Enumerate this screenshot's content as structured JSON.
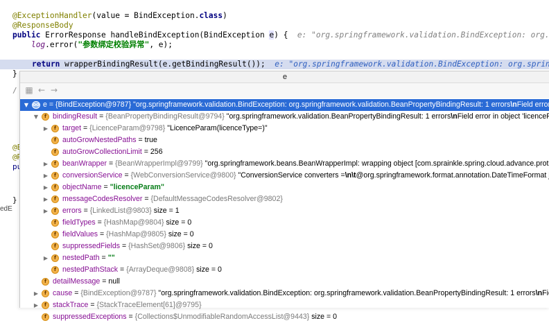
{
  "editor": {
    "line1_anno": "@ExceptionHandler",
    "line1_rest": "(value = BindException.",
    "line1_kw": "class",
    "line1_end": ")",
    "line2_anno": "@ResponseBody",
    "line3_kw": "public",
    "line3_text": " ErrorResponse handleBindException(BindException ",
    "line3_param": "e",
    "line3_end": ") {",
    "line3_hint": "  e: \"org.springframework.validation.BindException: org.",
    "line4_field": "log",
    "line4_text": ".error(",
    "line4_str": "\"参数绑定校验异常\"",
    "line4_end": ", e);",
    "line5_kw": "return",
    "line5_text": " wrapperBindingResult(e.getBindingResult());",
    "line5_hint": "  e: \"org.springframework.validation.BindException: org.sprin",
    "line6": "}",
    "frag_comment": "/",
    "frag_at1": "@E",
    "frag_at2": "@R",
    "frag_pu": "pu",
    "frag_close": "}",
    "frag_ed": "edE"
  },
  "popup": {
    "title": "e",
    "toolbar": {
      "icons": [
        "grid-icon",
        "back-arrow-icon",
        "forward-arrow-icon"
      ]
    },
    "rows": [
      {
        "twisty": "▼",
        "icon": "oo",
        "name": "e",
        "ref": "{BindException@9787}",
        "value": " \"org.springframework.validation.BindException: org.springframework.validation.BeanPropertyBindingResult: 1 errors",
        "bold": "\\n",
        "value2": "Field error in"
      },
      {
        "twisty": "▼",
        "icon": "f",
        "name": "bindingResult",
        "ref": "{BeanPropertyBindingResult@9794}",
        "value": " \"org.springframework.validation.BeanPropertyBindingResult: 1 errors",
        "bold": "\\n",
        "value2": "Field error in object 'licenceParam"
      },
      {
        "twisty": "▶",
        "icon": "f",
        "name": "target",
        "ref": "{LicenceParam@9798}",
        "value": " \"LicenceParam(licenceType=)\"",
        "bold": "",
        "value2": ""
      },
      {
        "twisty": "",
        "icon": "f",
        "name": "autoGrowNestedPaths",
        "ref": "",
        "value": " true",
        "bold": "",
        "value2": ""
      },
      {
        "twisty": "",
        "icon": "f",
        "name": "autoGrowCollectionLimit",
        "ref": "",
        "value": " 256",
        "bold": "",
        "value2": ""
      },
      {
        "twisty": "▶",
        "icon": "f",
        "name": "beanWrapper",
        "ref": "{BeanWrapperImpl@9799}",
        "value": " \"org.springframework.beans.BeanWrapperImpl: wrapping object [com.sprainkle.spring.cloud.advance.proto.li",
        "bold": "",
        "value2": ""
      },
      {
        "twisty": "▶",
        "icon": "f",
        "name": "conversionService",
        "ref": "{WebConversionService@9800}",
        "value": " \"ConversionService converters =",
        "bold": "\\n\\t",
        "value2": "@org.springframework.format.annotation.DateTimeFormat java"
      },
      {
        "twisty": "▶",
        "icon": "f",
        "name": "objectName",
        "ref": "",
        "value": "",
        "bold": "",
        "value2": "",
        "strval": "\"licenceParam\""
      },
      {
        "twisty": "▶",
        "icon": "f",
        "name": "messageCodesResolver",
        "ref": "{DefaultMessageCodesResolver@9802}",
        "value": "",
        "bold": "",
        "value2": ""
      },
      {
        "twisty": "▶",
        "icon": "f",
        "name": "errors",
        "ref": "{LinkedList@9803}",
        "value": "  size = 1",
        "bold": "",
        "value2": ""
      },
      {
        "twisty": "",
        "icon": "f",
        "name": "fieldTypes",
        "ref": "{HashMap@9804}",
        "value": "  size = 0",
        "bold": "",
        "value2": ""
      },
      {
        "twisty": "",
        "icon": "f",
        "name": "fieldValues",
        "ref": "{HashMap@9805}",
        "value": "  size = 0",
        "bold": "",
        "value2": ""
      },
      {
        "twisty": "",
        "icon": "f",
        "name": "suppressedFields",
        "ref": "{HashSet@9806}",
        "value": "  size = 0",
        "bold": "",
        "value2": ""
      },
      {
        "twisty": "▶",
        "icon": "f",
        "name": "nestedPath",
        "ref": "",
        "value": "",
        "bold": "",
        "value2": "",
        "strval": "\"\""
      },
      {
        "twisty": "",
        "icon": "f",
        "name": "nestedPathStack",
        "ref": "{ArrayDeque@9808}",
        "value": "  size = 0",
        "bold": "",
        "value2": ""
      },
      {
        "twisty": "",
        "icon": "f",
        "name": "detailMessage",
        "ref": "",
        "value": " null",
        "bold": "",
        "value2": ""
      },
      {
        "twisty": "▶",
        "icon": "f",
        "name": "cause",
        "ref": "{BindException@9787}",
        "value": " \"org.springframework.validation.BindException: org.springframework.validation.BeanPropertyBindingResult: 1 errors",
        "bold": "\\n",
        "value2": "Field"
      },
      {
        "twisty": "▶",
        "icon": "f",
        "name": "stackTrace",
        "ref": "{StackTraceElement[61]@9795}",
        "value": "",
        "bold": "",
        "value2": ""
      },
      {
        "twisty": "",
        "icon": "f",
        "name": "suppressedExceptions",
        "ref": "{Collections$UnmodifiableRandomAccessList@9443}",
        "value": "  size = 0",
        "bold": "",
        "value2": ""
      }
    ]
  },
  "colors": {
    "selection": "#2a6bd6",
    "current_line": "#d5dcef",
    "field_icon": "#f2b24a"
  }
}
